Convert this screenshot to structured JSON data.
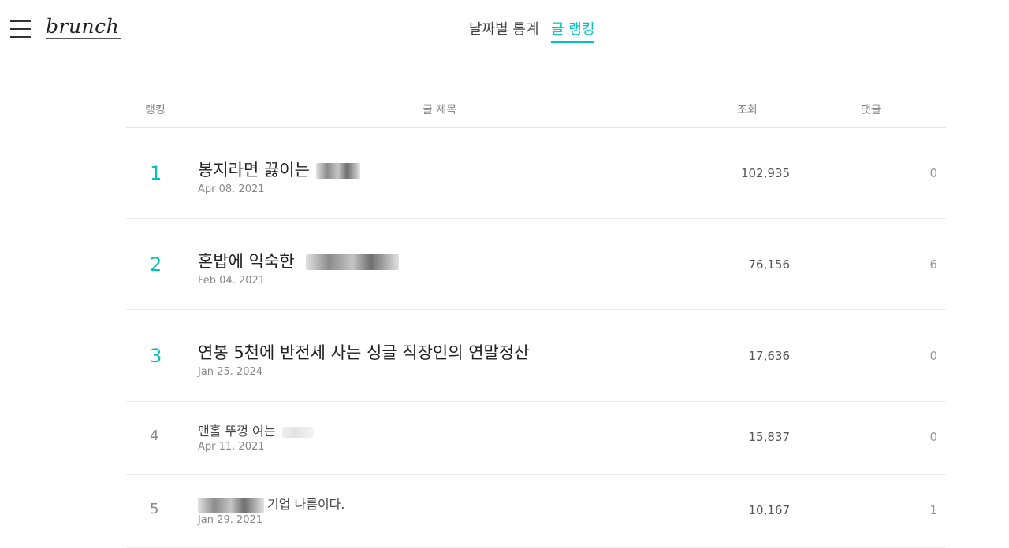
{
  "header": {
    "logo": "brunch",
    "tabs": [
      {
        "label": "날짜별 통계",
        "active": false
      },
      {
        "label": "글 랭킹",
        "active": true
      }
    ],
    "accent_color": "#00c3bd"
  },
  "table": {
    "columns": {
      "rank": "랭킹",
      "title": "글 제목",
      "views": "조회",
      "comments": "댓글"
    },
    "rows": [
      {
        "rank": "1",
        "title": "봉지라면 끓이는",
        "date": "Apr 08. 2021",
        "views": "102,935",
        "comments": "0"
      },
      {
        "rank": "2",
        "title": "혼밥에 익숙한",
        "date": "Feb 04. 2021",
        "views": "76,156",
        "comments": "6"
      },
      {
        "rank": "3",
        "title": "연봉 5천에 반전세 사는 싱글 직장인의 연말정산",
        "date": "Jan 25. 2024",
        "views": "17,636",
        "comments": "0"
      },
      {
        "rank": "4",
        "title": "맨홀 뚜껑 여는",
        "date": "Apr 11. 2021",
        "views": "15,837",
        "comments": "0"
      },
      {
        "rank": "5",
        "title": "기업 나름이다.",
        "date": "Jan 29. 2021",
        "views": "10,167",
        "comments": "1"
      }
    ]
  }
}
